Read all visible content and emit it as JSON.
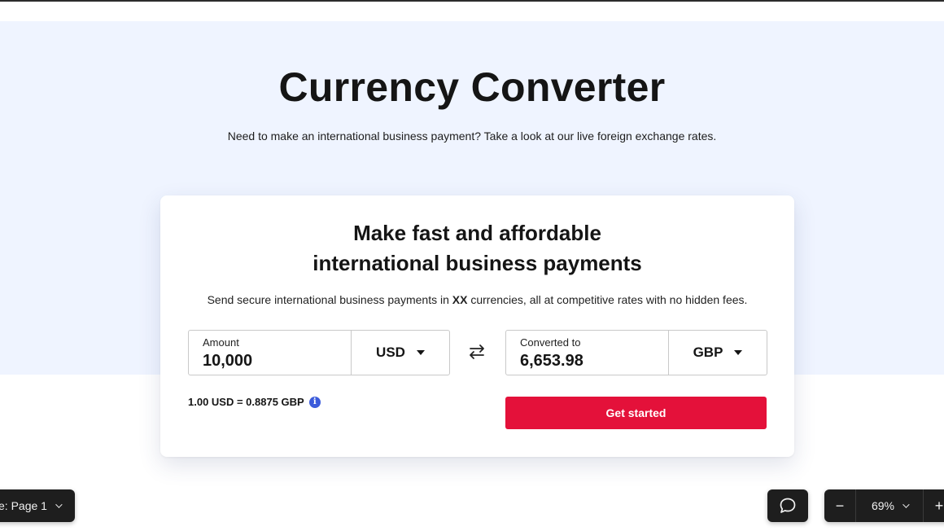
{
  "hero": {
    "title": "Currency Converter",
    "subtitle": "Need to make an international business payment? Take a look at our live foreign exchange rates."
  },
  "card": {
    "title_line1": "Make fast and affordable",
    "title_line2": "international business payments",
    "description_before": "Send secure international business payments in ",
    "description_bold": "XX",
    "description_after": " currencies, all at competitive rates with no hidden fees."
  },
  "amount_field": {
    "label": "Amount",
    "value": "10,000",
    "currency": "USD"
  },
  "converted_field": {
    "label": "Converted to",
    "value": "6,653.98",
    "currency": "GBP"
  },
  "rate": {
    "text": "1.00 USD = 0.8875 GBP",
    "info_icon_glyph": "i"
  },
  "cta": {
    "label": "Get started"
  },
  "toolbar": {
    "page_label": "e: Page 1",
    "zoom_minus": "−",
    "zoom_value": "69%",
    "zoom_plus": "+"
  },
  "colors": {
    "hero_background": "#eff4ff",
    "cta_background": "#e4113a",
    "info_icon": "#3b5bdb",
    "toolbar_background": "#1e1e1e"
  },
  "icons": {
    "swap": "swap-arrows-icon",
    "info": "info-icon",
    "comment": "comment-bubble-icon",
    "caret": "caret-down-icon",
    "chevron": "chevron-down-icon"
  }
}
